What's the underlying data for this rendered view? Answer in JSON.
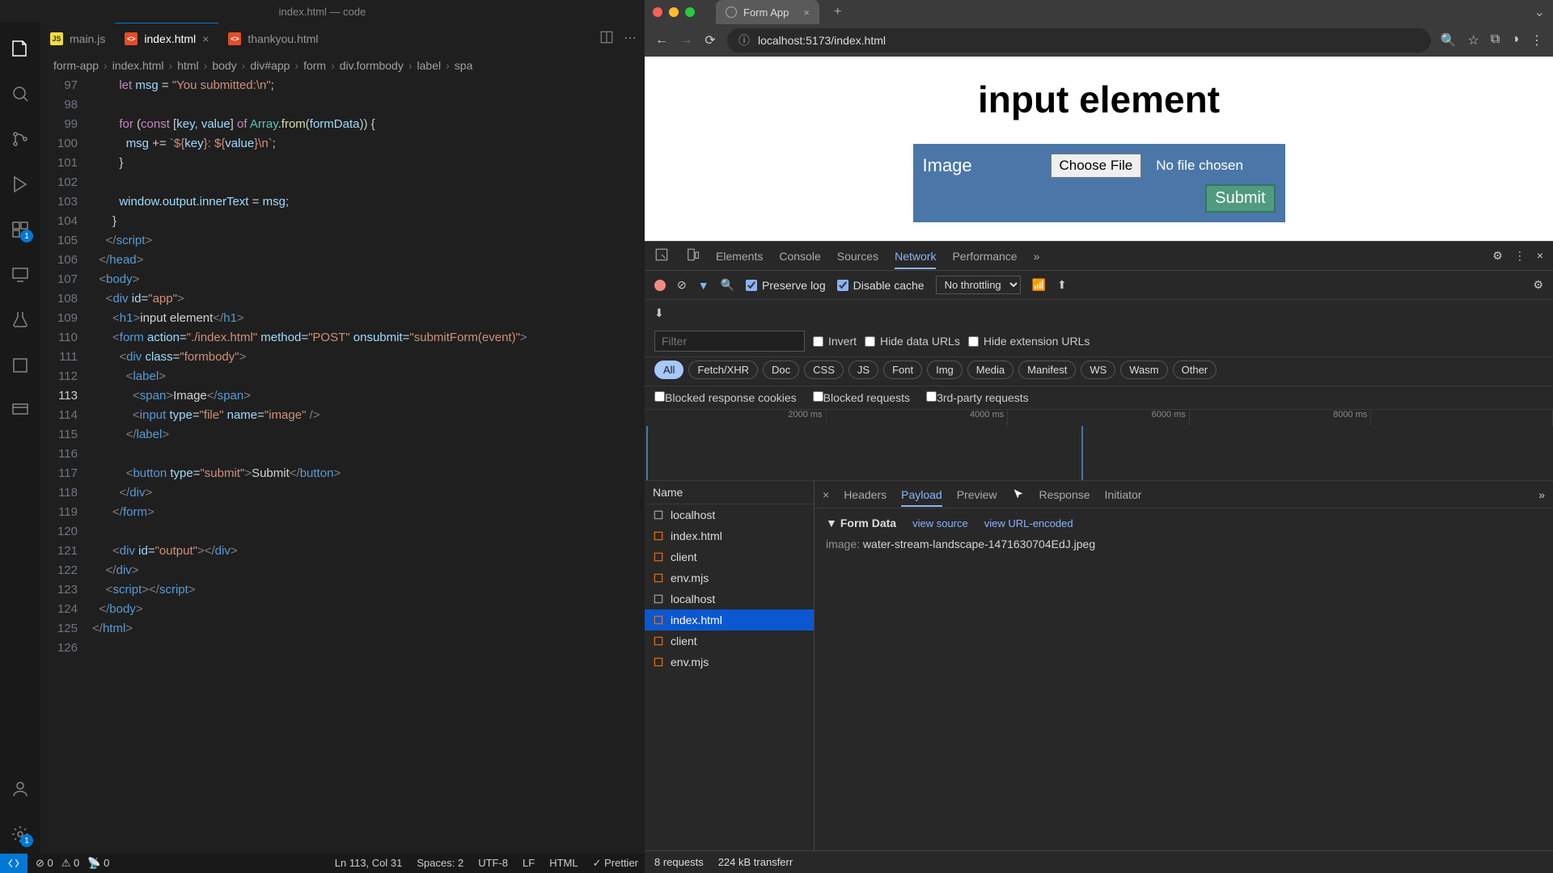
{
  "vscode": {
    "window_title": "index.html — code",
    "tabs": [
      {
        "icon": "JS",
        "name": "main.js",
        "active": false
      },
      {
        "icon": "<>",
        "name": "index.html",
        "active": true
      },
      {
        "icon": "<>",
        "name": "thankyou.html",
        "active": false
      }
    ],
    "breadcrumbs": [
      "form-app",
      "index.html",
      "html",
      "body",
      "div#app",
      "form",
      "div.formbody",
      "label",
      "spa"
    ],
    "line_numbers": [
      97,
      98,
      99,
      100,
      101,
      102,
      103,
      104,
      105,
      106,
      107,
      108,
      109,
      110,
      111,
      112,
      113,
      114,
      115,
      116,
      117,
      118,
      119,
      120,
      121,
      122,
      123,
      124,
      125,
      126
    ],
    "current_line": 113,
    "code": {
      "l97": [
        "let ",
        "msg",
        " = ",
        "\"You submitted:\\n\"",
        ";"
      ],
      "l99a": "for",
      "l99b": " (",
      "l99c": "const",
      "l99d": " [",
      "l99e": "key",
      "l99f": ", ",
      "l99g": "value",
      "l99h": "] ",
      "l99i": "of",
      "l99j": " Array.",
      "l99k": "from",
      "l99l": "(",
      "l99m": "formData",
      "l99n": ")) {",
      "l100a": "msg",
      " l100b": " += ",
      "l100c": "`${",
      "l100d": "key",
      "l100e": "}: ${",
      "l100f": "value",
      "l100g": "}\\n`",
      "l100h": ";",
      "l103a": "window",
      "l103b": ".",
      "l103c": "output",
      "l103d": ".",
      "l103e": "innerText",
      "l103f": " = ",
      "l103g": "msg",
      "l103h": ";",
      "h1_text": "input element",
      "action": "\"./index.html\"",
      "method": "\"POST\"",
      "onsubmit": "\"submitForm(event)\"",
      "formbody": "\"formbody\"",
      "file": "\"file\"",
      "imagename": "\"image\"",
      "submit_type": "\"submit\"",
      "submit_text": "Submit",
      "output": "\"output\"",
      "app": "\"app\"",
      "span_text": "Image"
    },
    "statusbar": {
      "errors": "0",
      "warnings": "0",
      "ports": "0",
      "cursor": "Ln 113, Col 31",
      "spaces": "Spaces: 2",
      "encoding": "UTF-8",
      "eol": "LF",
      "lang": "HTML",
      "prettier": "✓ Prettier"
    },
    "activity_badges": {
      "ext": "1",
      "settings": "1"
    }
  },
  "chrome": {
    "tab_title": "Form App",
    "url": "localhost:5173/index.html",
    "page": {
      "heading": "input element",
      "label": "Image",
      "choose": "Choose File",
      "no_file": "No file chosen",
      "submit": "Submit"
    },
    "devtools": {
      "tabs": [
        "Elements",
        "Console",
        "Sources",
        "Network",
        "Performance"
      ],
      "active_tab": "Network",
      "preserve_log": "Preserve log",
      "disable_cache": "Disable cache",
      "throttling": "No throttling",
      "filter_placeholder": "Filter",
      "invert": "Invert",
      "hide_data": "Hide data URLs",
      "hide_ext": "Hide extension URLs",
      "chips": [
        "All",
        "Fetch/XHR",
        "Doc",
        "CSS",
        "JS",
        "Font",
        "Img",
        "Media",
        "Manifest",
        "WS",
        "Wasm",
        "Other"
      ],
      "blocked_cookies": "Blocked response cookies",
      "blocked_req": "Blocked requests",
      "third_party": "3rd-party requests",
      "timeline_ticks": [
        "2000 ms",
        "4000 ms",
        "6000 ms",
        "8000 ms"
      ],
      "name_col": "Name",
      "requests": [
        "localhost",
        "index.html",
        "client",
        "env.mjs",
        "localhost",
        "index.html",
        "client",
        "env.mjs"
      ],
      "selected_request_index": 5,
      "detail_tabs": [
        "Headers",
        "Payload",
        "Preview",
        "Response",
        "Initiator"
      ],
      "detail_active": "Payload",
      "form_data_title": "Form Data",
      "view_source": "view source",
      "view_url": "view URL-encoded",
      "payload_key": "image:",
      "payload_val": " water-stream-landscape-1471630704EdJ.jpeg",
      "summary_requests": "8 requests",
      "summary_transfer": "224 kB transferr"
    }
  }
}
